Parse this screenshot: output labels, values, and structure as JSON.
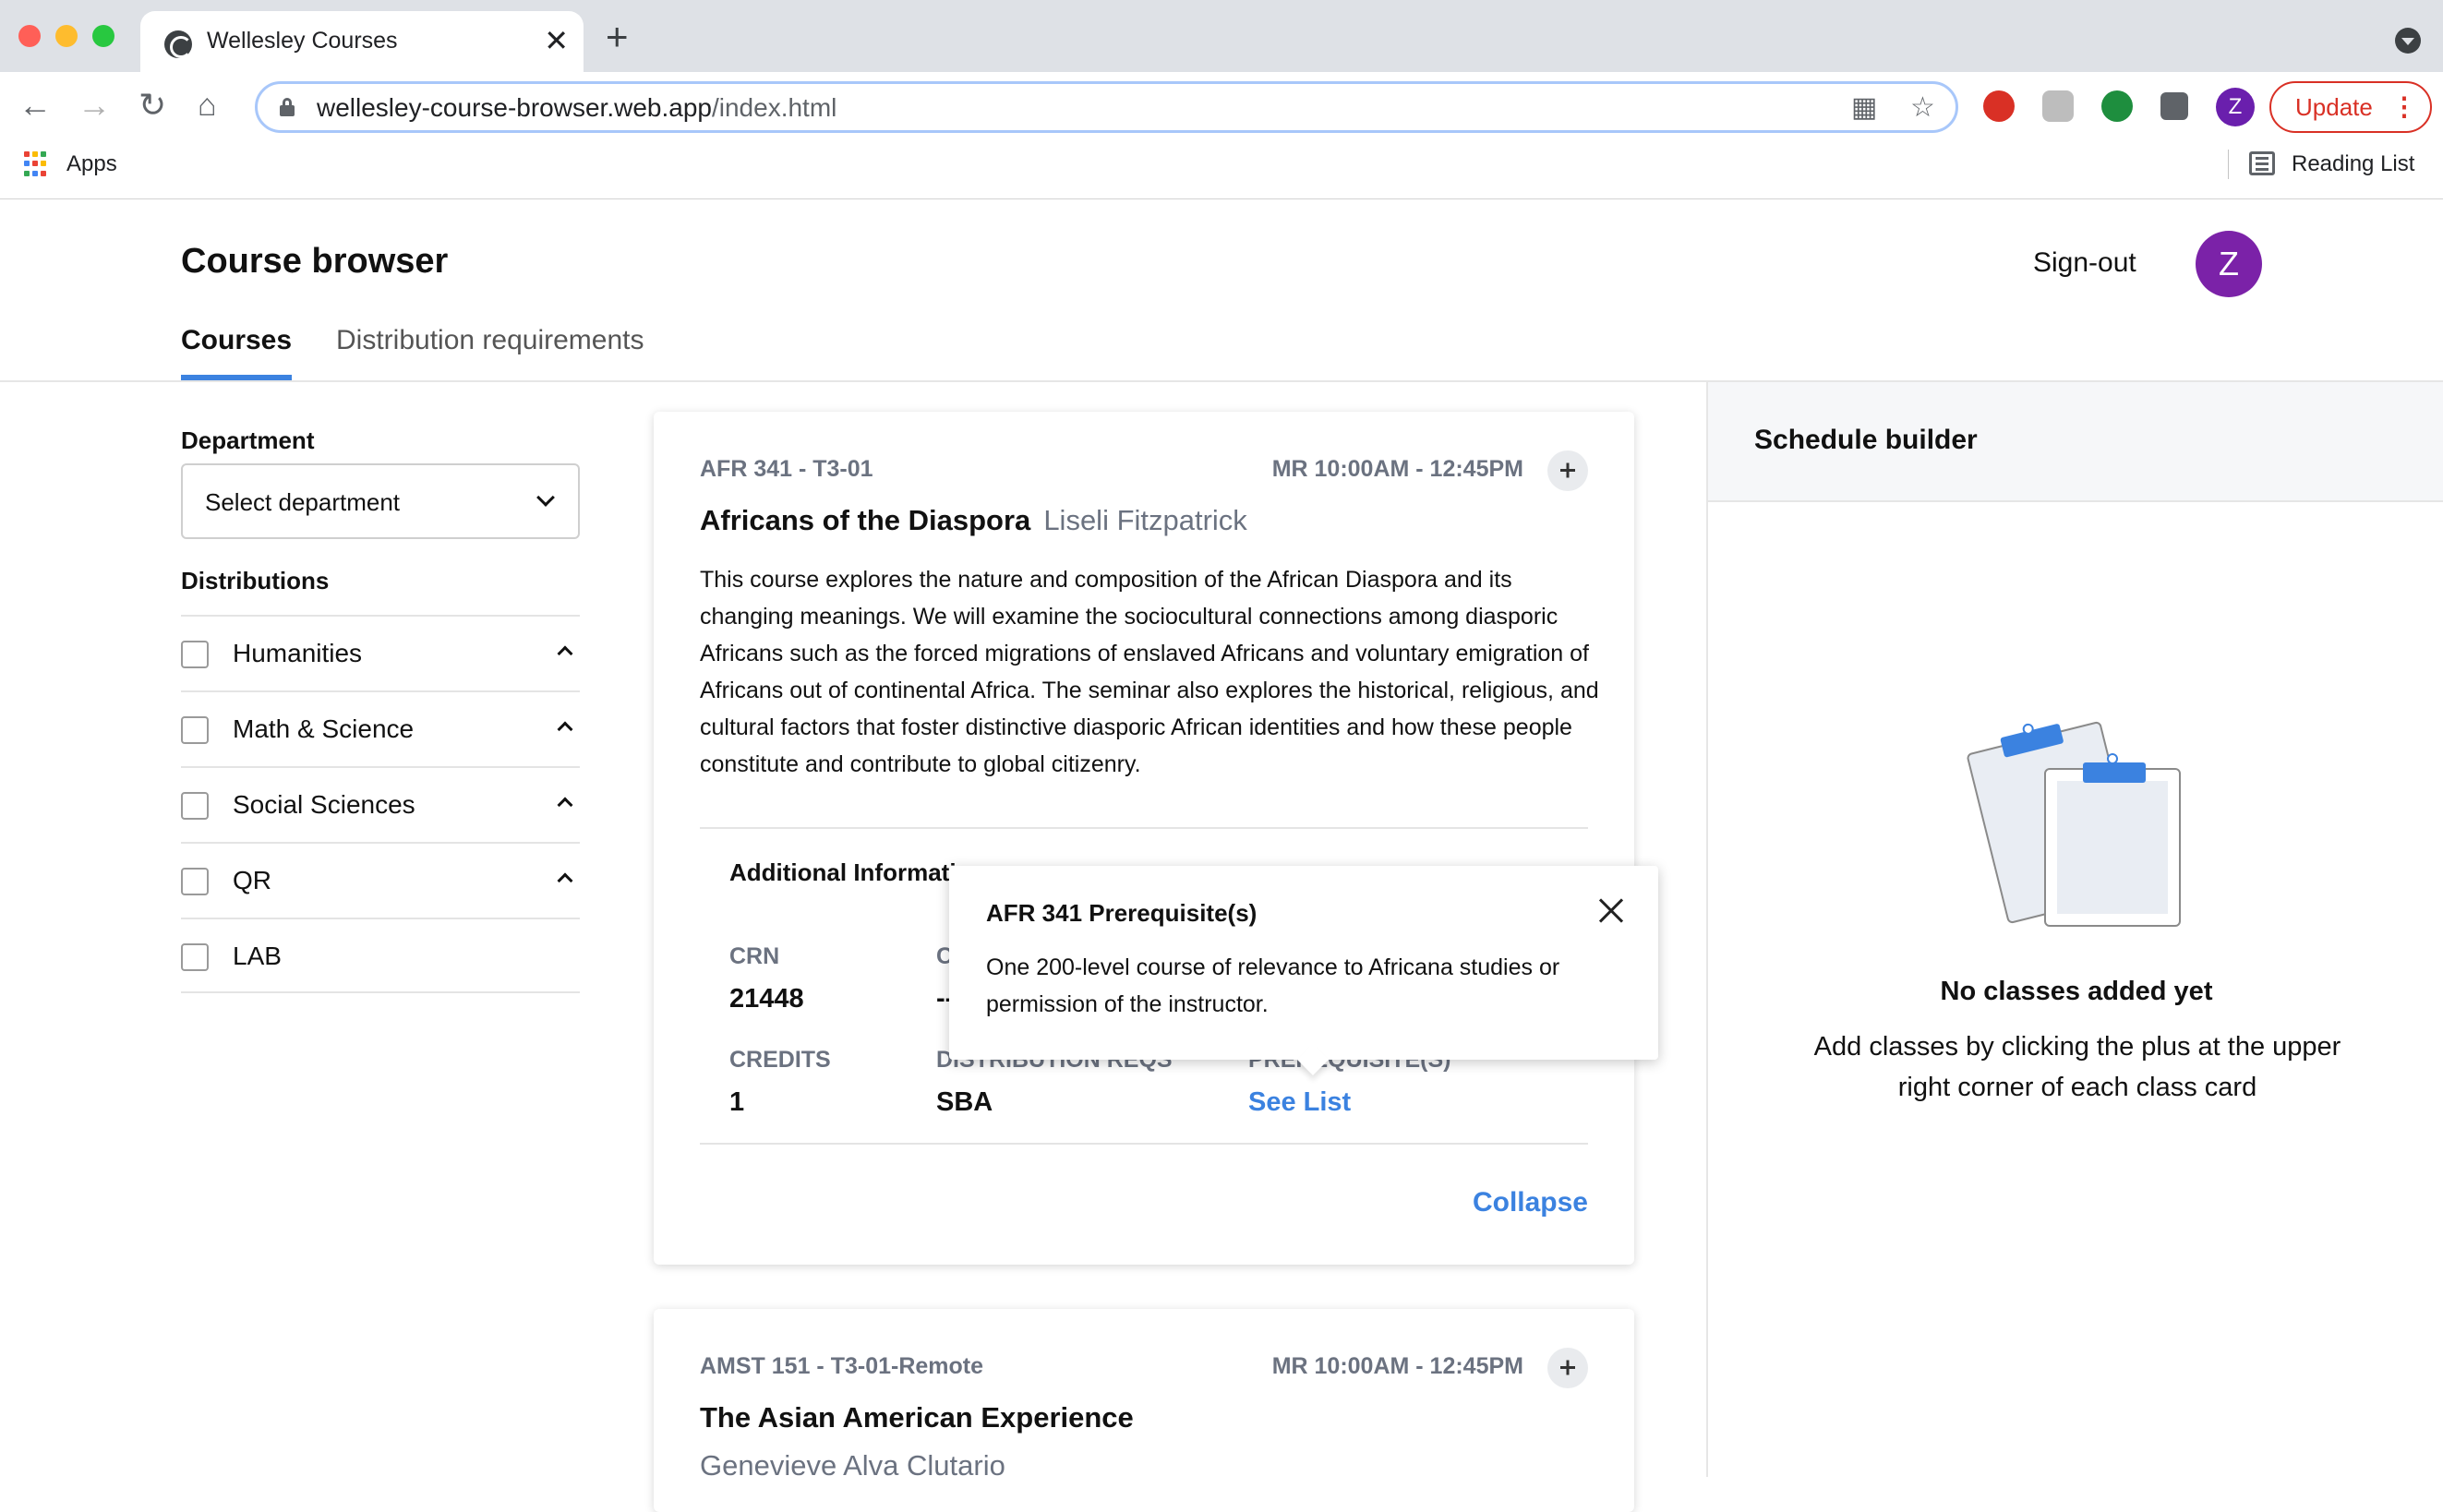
{
  "browser": {
    "tab_title": "Wellesley Courses",
    "url_host": "wellesley-course-browser.web.app",
    "url_path": "/index.html",
    "profile_initial": "Z",
    "update_label": "Update",
    "apps_label": "Apps",
    "reading_list_label": "Reading List"
  },
  "app": {
    "title": "Course browser",
    "signout_label": "Sign-out",
    "avatar_initial": "Z",
    "tabs": [
      {
        "label": "Courses",
        "active": true
      },
      {
        "label": "Distribution requirements",
        "active": false
      }
    ]
  },
  "sidebar": {
    "department_label": "Department",
    "department_select_value": "Select department",
    "distributions_label": "Distributions",
    "distributions": [
      {
        "label": "Humanities",
        "checked": false,
        "expandable": true
      },
      {
        "label": "Math & Science",
        "checked": false,
        "expandable": true
      },
      {
        "label": "Social Sciences",
        "checked": false,
        "expandable": true
      },
      {
        "label": "QR",
        "checked": false,
        "expandable": true
      },
      {
        "label": "LAB",
        "checked": false,
        "expandable": false
      }
    ]
  },
  "courses": [
    {
      "code": "AFR 341 - T3-01",
      "time": "MR 10:00AM - 12:45PM",
      "title": "Africans of the Diaspora",
      "professor": "Liseli Fitzpatrick",
      "description": "This course explores the nature and composition of the African Diaspora and its changing meanings. We will examine the sociocultural connections among diasporic Africans such as the forced migrations of enslaved Africans and voluntary emigration of Africans out of continental Africa. The seminar also explores the historical, religious, and cultural factors that foster distinctive diasporic African identities and how these people constitute and contribute to global citizenry.",
      "additional_info_label": "Additional Informati",
      "crn_label": "CRN",
      "crn": "21448",
      "col2_label_partial": "C",
      "col2_value_partial": "--",
      "credits_label": "CREDITS",
      "credits": "1",
      "distribution_label": "DISTRIBUTION REQS",
      "distribution": "SBA",
      "prereq_label": "PREREQUISITE(S)",
      "prereq_link": "See List",
      "collapse_label": "Collapse"
    },
    {
      "code": "AMST 151 - T3-01-Remote",
      "time": "MR 10:00AM - 12:45PM",
      "title": "The Asian American Experience",
      "professor": "Genevieve Alva Clutario"
    }
  ],
  "popover": {
    "title": "AFR 341 Prerequisite(s)",
    "body": "One 200-level course of relevance to Africana studies or permission of the instructor."
  },
  "schedule": {
    "title": "Schedule builder",
    "empty_title": "No classes added yet",
    "empty_subtitle": "Add classes by clicking the plus at the upper right corner of each class card"
  },
  "colors": {
    "accent": "#3b82e0",
    "avatar": "#7b22a8",
    "update_red": "#d93025"
  }
}
